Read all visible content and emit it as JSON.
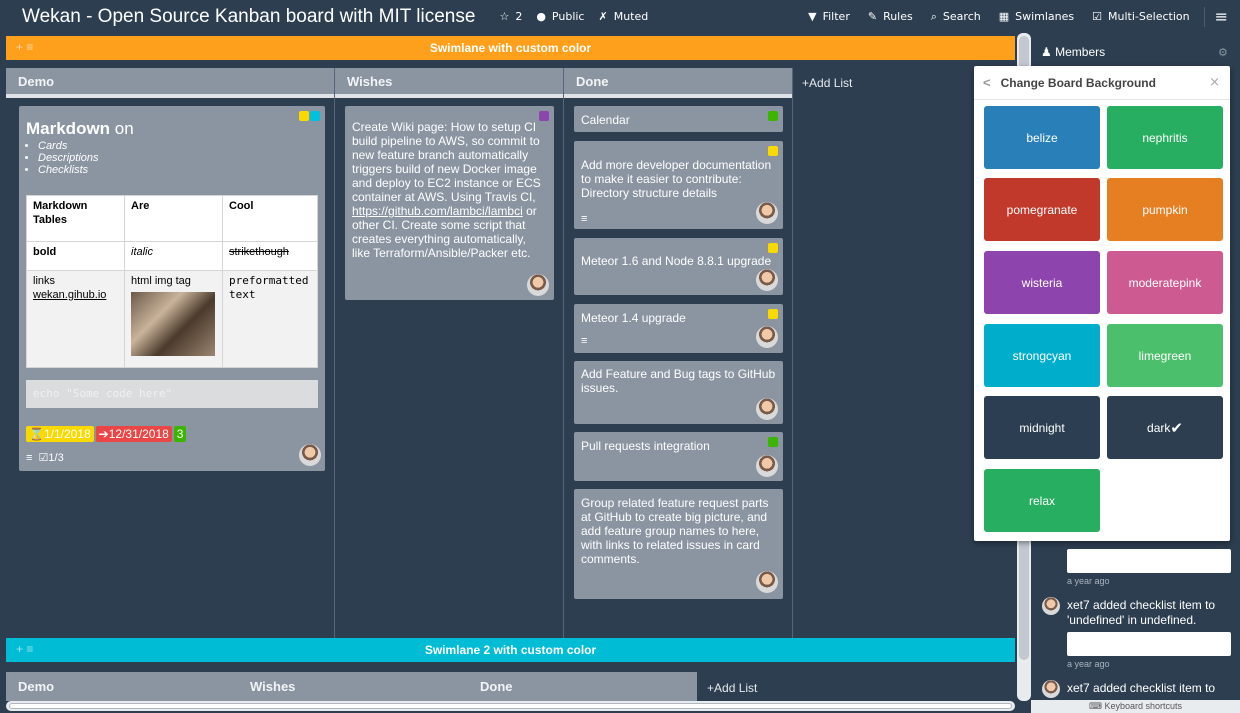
{
  "header": {
    "board_title": "Wekan - Open Source Kanban board with MIT license",
    "stars": "2",
    "visibility": "Public",
    "watch": "Muted",
    "filter": "Filter",
    "rules": "Rules",
    "search": "Search",
    "view": "Swimlanes",
    "multi_selection": "Multi-Selection"
  },
  "swimlanes": [
    {
      "title": "Swimlane with custom color",
      "color": "#ffa01c",
      "lists": [
        "Demo",
        "Wishes",
        "Done"
      ],
      "add_list": "Add List"
    },
    {
      "title": "Swimlane 2 with custom color",
      "color": "#00bcd4",
      "lists": [
        "Demo",
        "Wishes",
        "Done"
      ],
      "add_list": "Add List"
    }
  ],
  "demo_card": {
    "title_bold": "Markdown",
    "title_rest": " on",
    "bullets": [
      "Cards",
      "Descriptions",
      "Checklists"
    ],
    "table": {
      "headers": [
        "Markdown Tables",
        "Are",
        "Cool"
      ],
      "row1": [
        "bold",
        "italic",
        "strikethough"
      ],
      "row2": [
        "links",
        "html img tag",
        "preformatted text"
      ],
      "link_text": "wekan.gihub.io"
    },
    "code": "echo \"Some code here\"",
    "start_date": "1/1/2018",
    "due_date": "12/31/2018",
    "spent": "3",
    "checklist": "1/3",
    "label_colors": [
      "#fad900",
      "#00c2e0"
    ]
  },
  "wishes_card": {
    "text_1": "Create Wiki page: How to setup CI build pipeline to AWS, so commit to new feature branch automatically triggers build of new Docker image and deploy to EC2 instance or ECS container at AWS. Using Travis CI, ",
    "link": "https://github.com/lambci/lambci",
    "text_2": " or other CI. Create some script that creates everything automatically, like Terraform/Ansible/Packer etc.",
    "label_color": "#8e44ad"
  },
  "done_cards": [
    {
      "title": "Calendar",
      "label": "#3cb500"
    },
    {
      "title": "Add more developer documentation to make it easier to contribute: Directory structure details",
      "label": "#fad900"
    },
    {
      "title": "Meteor 1.6 and Node 8.8.1 upgrade",
      "label": "#fad900"
    },
    {
      "title": "Meteor 1.4 upgrade",
      "label": "#fad900"
    },
    {
      "title": "Add Feature and Bug tags to GitHub issues.",
      "label": ""
    },
    {
      "title": "Pull requests integration",
      "label": "#3cb500"
    },
    {
      "title": "Group related feature request parts at GitHub to create big picture, and add feature group names to here, with links to related issues in card comments.",
      "label": ""
    }
  ],
  "sidebar": {
    "members": "Members",
    "activities": [
      {
        "time": "a year ago"
      },
      {
        "text": "xet7 added checklist item to 'undefined' in undefined."
      },
      {
        "time": "a year ago"
      },
      {
        "text": "xet7 added checklist item to"
      }
    ],
    "keyboard_shortcuts": "Keyboard shortcuts"
  },
  "popup": {
    "title": "Change Board Background",
    "colors": [
      {
        "name": "belize",
        "hex": "#2980b9"
      },
      {
        "name": "nephritis",
        "hex": "#27ae60"
      },
      {
        "name": "pomegranate",
        "hex": "#c0392b"
      },
      {
        "name": "pumpkin",
        "hex": "#e67e22"
      },
      {
        "name": "wisteria",
        "hex": "#8e44ad"
      },
      {
        "name": "moderatepink",
        "hex": "#cd5a91"
      },
      {
        "name": "strongcyan",
        "hex": "#00aecc"
      },
      {
        "name": "limegreen",
        "hex": "#4bbf6b"
      },
      {
        "name": "midnight",
        "hex": "#2c3e51"
      },
      {
        "name": "dark",
        "hex": "#2c3e50",
        "selected": true
      },
      {
        "name": "relax",
        "hex": "#27ae61"
      }
    ]
  }
}
